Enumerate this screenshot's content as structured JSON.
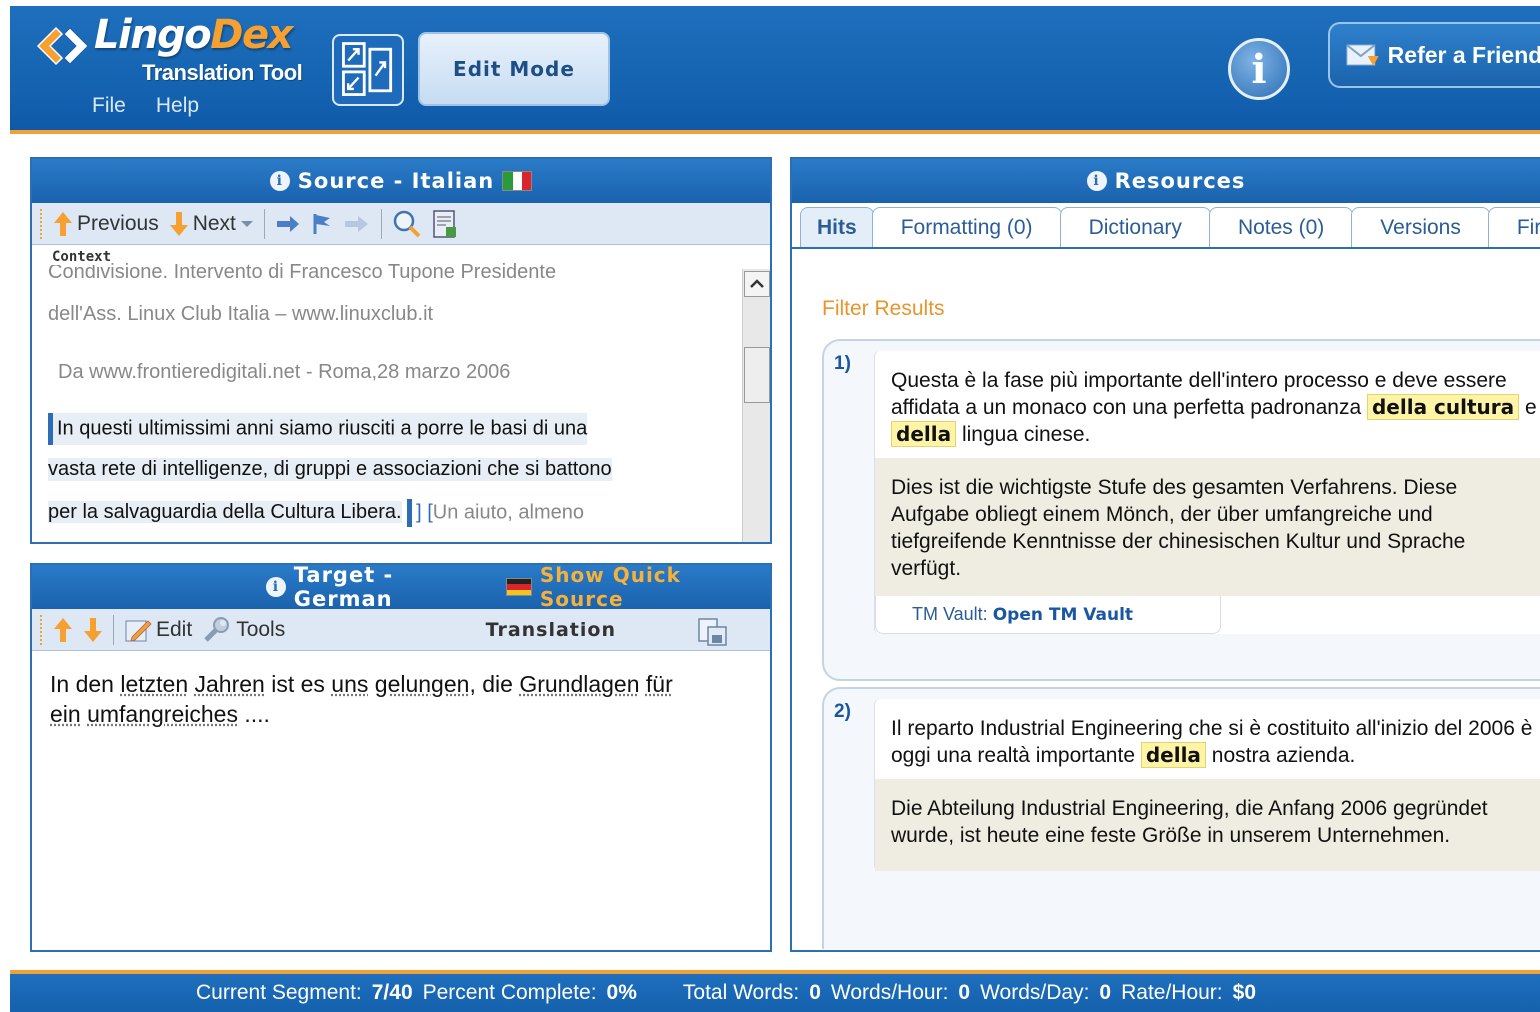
{
  "app": {
    "logo_name_a": "Lingo",
    "logo_name_b": "Dex",
    "logo_sub": "Translation Tool",
    "menu": [
      {
        "label": "File"
      },
      {
        "label": "Help"
      }
    ],
    "edit_mode_label": "Edit Mode",
    "refer_label": "Refer a Friend!",
    "colors": {
      "header_blue": "#1565b3",
      "accent_orange": "#f0a23a",
      "highlight": "#fdf4a8"
    }
  },
  "source": {
    "title": "Source - Italian",
    "toolbar": {
      "previous": "Previous",
      "next": "Next"
    },
    "context_label": "Context",
    "lines": [
      "Condivisione.   Intervento di Francesco Tupone Presidente",
      "dell'Ass.   Linux Club Italia – www.linuxclub.it",
      "Da www.frontieredigitali.net - Roma,28 marzo 2006",
      "In questi ultimissimi anni siamo riusciti a porre le basi di una",
      "vasta rete di intelligenze, di gruppi e associazioni che si battono",
      "per la salvaguardia della Cultura Libera."
    ],
    "next_segment_bracket": "[",
    "next_segment_preview": "Un aiuto, almeno"
  },
  "target": {
    "title": "Target - German",
    "quick_source_label": "Show Quick Source",
    "toolbar": {
      "edit": "Edit",
      "tools": "Tools",
      "mode": "Translation"
    },
    "text_words": [
      "In den",
      "letzten",
      "Jahren",
      "ist es",
      "uns",
      "gelungen",
      ", die",
      "Grundlagen",
      "für",
      "ein",
      "umfangreiches",
      " ...."
    ]
  },
  "resources": {
    "title": "Resources",
    "tabs": [
      {
        "label": "Hits"
      },
      {
        "label": "Formatting (0)"
      },
      {
        "label": "Dictionary"
      },
      {
        "label": "Notes (0)"
      },
      {
        "label": "Versions"
      },
      {
        "label": "Fir"
      }
    ],
    "filter_label": "Filter Results",
    "results": [
      {
        "num": "1)",
        "src_pre": "Questa è la fase più importante dell'intero processo e deve essere affidata a un monaco con una perfetta padronanza",
        "hl1": "della cultura",
        "mid": "e",
        "hl2": "della",
        "src_post": "lingua cinese.",
        "tgt": "Dies ist die wichtigste Stufe des gesamten Verfahrens. Diese Aufgabe obliegt einem Mönch, der über umfangreiche und tiefgreifende Kenntnisse der chinesischen Kultur und Sprache verfügt.",
        "vault_label": "TM Vault:",
        "vault_link": "Open TM Vault"
      },
      {
        "num": "2)",
        "src_pre": "Il reparto Industrial Engineering che si è costituito all'inizio del 2006 è oggi una realtà importante",
        "hl1": "della",
        "src_post": "nostra azienda.",
        "tgt": "Die Abteilung Industrial Engineering, die Anfang 2006 gegründet wurde, ist heute eine feste Größe in unserem Unternehmen."
      }
    ]
  },
  "status": {
    "current_segment_label": "Current Segment:",
    "current_segment_value": "7/40",
    "percent_label": "Percent Complete:",
    "percent_value": "0%",
    "total_words_label": "Total Words:",
    "total_words_value": "0",
    "words_hour_label": "Words/Hour:",
    "words_hour_value": "0",
    "words_day_label": "Words/Day:",
    "words_day_value": "0",
    "rate_hour_label": "Rate/Hour:",
    "rate_hour_value": "$0"
  }
}
